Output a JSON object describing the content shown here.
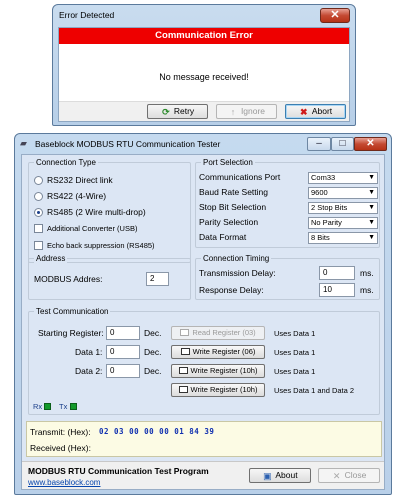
{
  "error_dialog": {
    "title": "Error Detected",
    "close_glyph": "✕",
    "banner": "Communication Error",
    "message": "No message received!",
    "buttons": {
      "retry": "Retry",
      "ignore": "Ignore",
      "abort": "Abort"
    }
  },
  "main_window": {
    "title": "Baseblock MODBUS RTU Communication Tester",
    "controls": {
      "minimize": "–",
      "maximize": "□",
      "close": "✕"
    }
  },
  "connection_type": {
    "title": "Connection Type",
    "options": [
      "RS232 Direct link",
      "RS422 (4-Wire)",
      "RS485 (2 Wire multi-drop)"
    ],
    "selected": 2,
    "checks": [
      "Additional Converter (USB)",
      "Echo back suppression (RS485)"
    ]
  },
  "port_selection": {
    "title": "Port Selection",
    "rows": [
      {
        "label": "Communications Port",
        "value": "Com33"
      },
      {
        "label": "Baud Rate Setting",
        "value": "9600"
      },
      {
        "label": "Stop Bit Selection",
        "value": "2 Stop Bits"
      },
      {
        "label": "Parity Selection",
        "value": "No Parity"
      },
      {
        "label": "Data Format",
        "value": "8 Bits"
      }
    ]
  },
  "address": {
    "title": "Address",
    "label": "MODBUS Addres:",
    "value": "2"
  },
  "connection_timing": {
    "title": "Connection Timing",
    "transmission_label": "Transmission Delay:",
    "transmission_value": "0",
    "response_label": "Response Delay:",
    "response_value": "10",
    "unit": "ms."
  },
  "test_communication": {
    "title": "Test Communication",
    "unit": "Dec.",
    "rows": [
      {
        "label": "Starting Register:",
        "value": "0",
        "button": "Read Register (03)",
        "note": "Uses Data 1"
      },
      {
        "label": "Data 1:",
        "value": "0",
        "button": "Write Register (06)",
        "note": "Uses Data 1"
      },
      {
        "label": "Data 2:",
        "value": "0",
        "button": "Write Register (10h)",
        "note": "Uses Data 1"
      },
      {
        "label": "",
        "value": "",
        "button": "Write Register (10h)",
        "note": "Uses Data 1 and Data 2"
      }
    ],
    "rx_label": "Rx",
    "tx_label": "Tx"
  },
  "transmit": {
    "transmit_label": "Transmit: (Hex):",
    "transmit_value": "02 03 00 00 00 01 84 39",
    "received_label": "Received (Hex):"
  },
  "footer": {
    "title": "MODBUS RTU Communication Test Program",
    "link": "www.baseblock.com",
    "about": "About",
    "close": "Close"
  }
}
